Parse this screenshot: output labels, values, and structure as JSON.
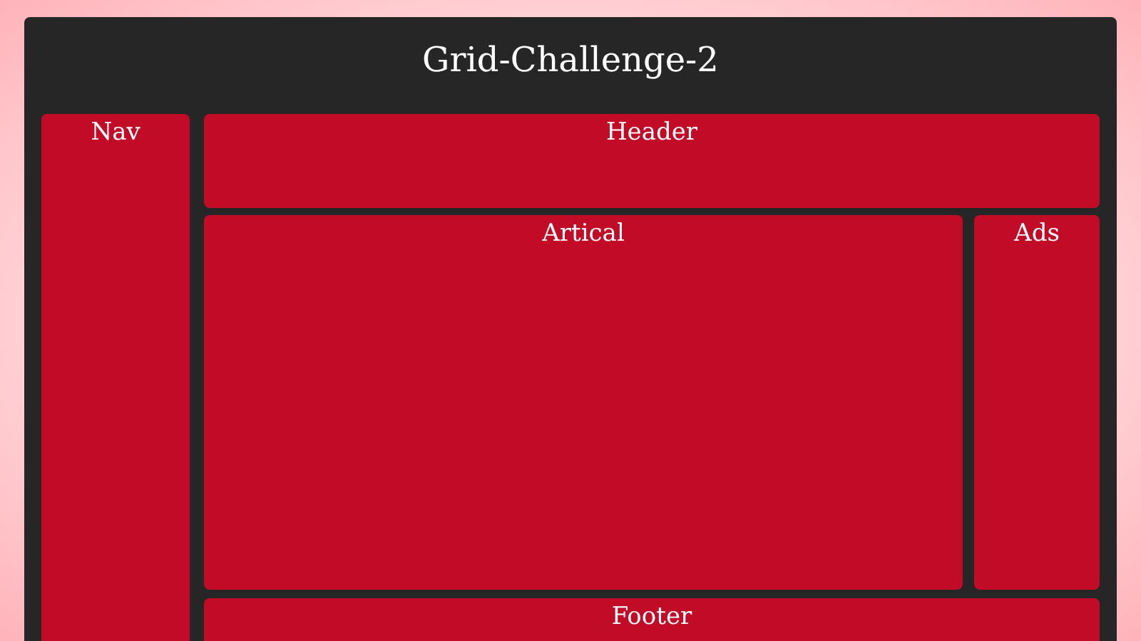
{
  "title": "Grid-Challenge-2",
  "areas": {
    "nav": "Nav",
    "header": "Header",
    "article": "Artical",
    "ads": "Ads",
    "footer": "Footer"
  }
}
